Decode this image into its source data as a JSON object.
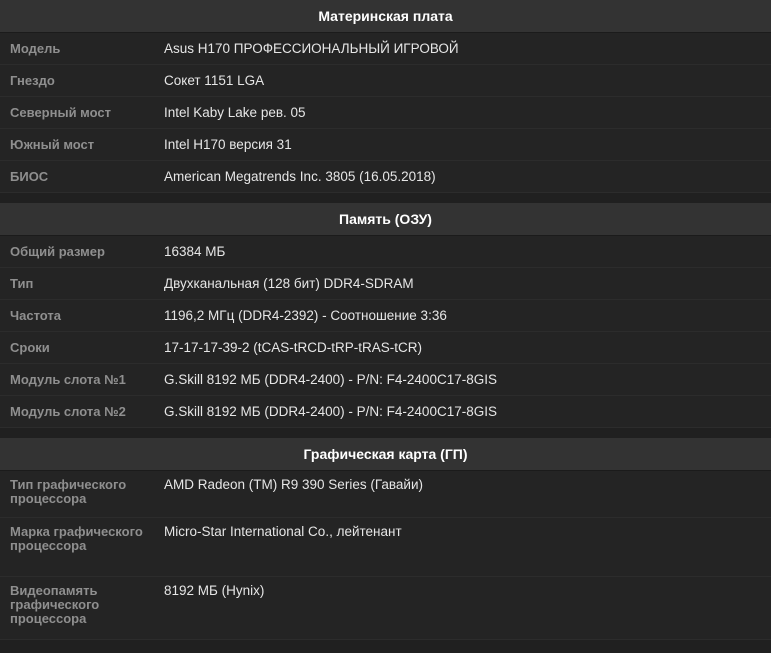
{
  "sections": [
    {
      "title": "Материнская плата",
      "rows": [
        {
          "label": "Модель",
          "value": "Asus H170 ПРОФЕССИОНАЛЬНЫЙ ИГРОВОЙ"
        },
        {
          "label": "Гнездо",
          "value": "Сокет 1151 LGA"
        },
        {
          "label": "Северный мост",
          "value": "Intel Kaby Lake рев. 05"
        },
        {
          "label": "Южный мост",
          "value": "Intel H170 версия 31"
        },
        {
          "label": "БИОС",
          "value": "American Megatrends Inc. 3805 (16.05.2018)"
        }
      ]
    },
    {
      "title": "Память (ОЗУ)",
      "rows": [
        {
          "label": "Общий размер",
          "value": "16384 МБ"
        },
        {
          "label": "Тип",
          "value": "Двухканальная (128 бит) DDR4-SDRAM"
        },
        {
          "label": "Частота",
          "value": "1196,2 МГц (DDR4-2392) - Соотношение 3:36"
        },
        {
          "label": "Сроки",
          "value": "17-17-17-39-2 (tCAS-tRCD-tRP-tRAS-tCR)"
        },
        {
          "label": "Модуль слота №1",
          "value": "G.Skill 8192 МБ (DDR4-2400) - P/N: F4-2400C17-8GIS"
        },
        {
          "label": "Модуль слота №2",
          "value": "G.Skill 8192 МБ (DDR4-2400) - P/N: F4-2400C17-8GIS"
        }
      ]
    },
    {
      "title": "Графическая карта (ГП)",
      "rows": [
        {
          "label": "Тип графического процессора",
          "value": "AMD Radeon (TM) R9 390 Series (Гавайи)"
        },
        {
          "label": "Марка графического процессора",
          "value": "Micro-Star International Co., лейтенант"
        },
        {
          "label": "Видеопамять графического процессора",
          "value": "8192 МБ (Hynix)"
        }
      ]
    }
  ]
}
